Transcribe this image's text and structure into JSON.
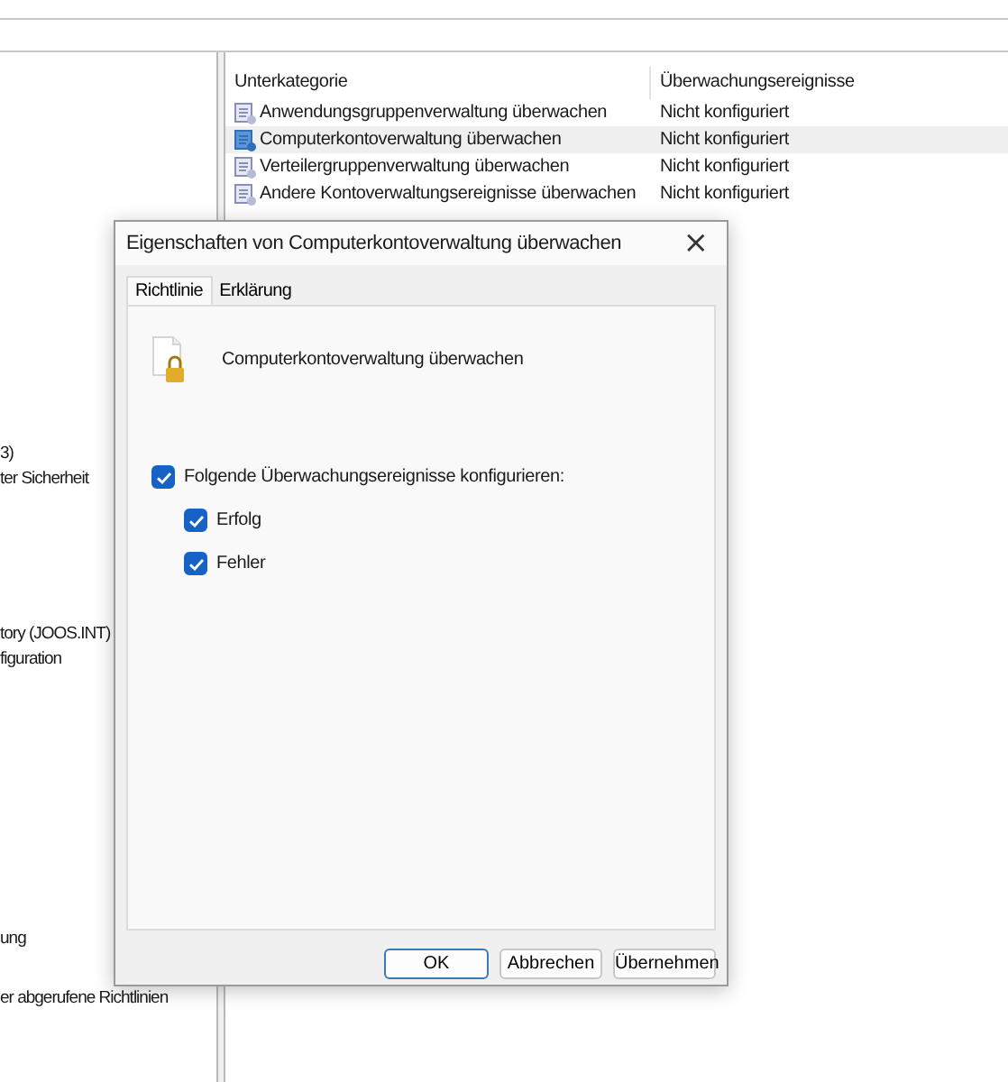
{
  "tree": {
    "items": [
      {
        "text": "3)"
      },
      {
        "text": "ter Sicherheit"
      },
      {
        "text": "tory (JOOS.INT)"
      },
      {
        "text": "figuration"
      },
      {
        "text": "ung"
      },
      {
        "text": "er abgerufene Richtlinien"
      }
    ]
  },
  "list": {
    "columns": [
      "Unterkategorie",
      "Überwachungsereignisse"
    ],
    "rows": [
      {
        "name": "Anwendungsgruppenverwaltung überwachen",
        "value": "Nicht konfiguriert",
        "selected": false
      },
      {
        "name": "Computerkontoverwaltung überwachen",
        "value": "Nicht konfiguriert",
        "selected": true
      },
      {
        "name": "Verteilergruppenverwaltung überwachen",
        "value": "Nicht konfiguriert",
        "selected": false
      },
      {
        "name": "Andere Kontoverwaltungsereignisse überwachen",
        "value": "Nicht konfiguriert",
        "selected": false
      }
    ]
  },
  "dialog": {
    "title": "Eigenschaften von Computerkontoverwaltung überwachen",
    "close": "×",
    "tabs": [
      {
        "label": "Richtlinie",
        "selected": true
      },
      {
        "label": "Erklärung",
        "selected": false
      }
    ],
    "policy": "Computerkontoverwaltung überwachen",
    "configure": {
      "label": "Folgende Überwachungsereignisse konfigurieren:",
      "checked": true,
      "children": [
        {
          "label": "Erfolg",
          "checked": true
        },
        {
          "label": "Fehler",
          "checked": true
        }
      ]
    },
    "buttons": [
      {
        "label": "OK",
        "default": true
      },
      {
        "label": "Abbrechen",
        "default": false
      },
      {
        "label": "Übernehmen",
        "default": false
      }
    ]
  }
}
